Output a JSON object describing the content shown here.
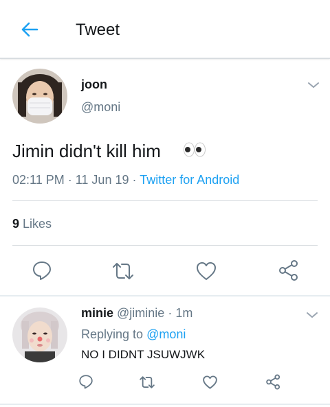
{
  "header": {
    "title": "Tweet"
  },
  "tweet": {
    "author_name": "joon",
    "author_handle": "@moni",
    "text": "Jimin didn't kill him",
    "time": "02:11 PM",
    "sep1": "·",
    "date": "11 Jun 19",
    "sep2": "·",
    "source": "Twitter for Android",
    "likes_count": "9",
    "likes_label": "Likes"
  },
  "reply": {
    "name": "minie",
    "handle": "@jiminie",
    "sep": "·",
    "age": "1m",
    "replying_prefix": "Replying to",
    "replying_to": "@moni",
    "text": "NO I DIDNT JSUWJWK"
  },
  "colors": {
    "accent": "#1da1f2",
    "muted": "#657786",
    "icon": "#657786",
    "divider": "#d9dde1"
  },
  "icons": [
    "back-arrow-icon",
    "chevron-down-icon",
    "eyes-emoji-icon",
    "reply-icon",
    "retweet-icon",
    "like-icon",
    "share-icon"
  ]
}
